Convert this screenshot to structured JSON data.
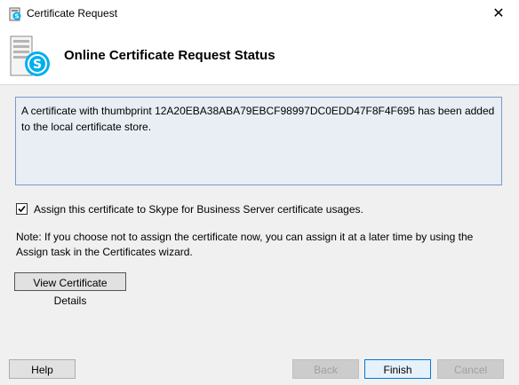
{
  "window": {
    "title": "Certificate Request",
    "close_glyph": "✕",
    "icon": "skype-certificate-icon"
  },
  "header": {
    "title": "Online Certificate Request Status",
    "icon": "server-skype-icon"
  },
  "status": {
    "message": "A certificate with thumbprint 12A20EBA38ABA79EBCF98997DC0EDD47F8F4F695 has been added to the local certificate store."
  },
  "assign": {
    "checked": true,
    "label": "Assign this certificate to Skype for Business Server certificate usages."
  },
  "note": "Note: If you choose not to assign the certificate now, you can assign it at a later time by using the Assign task in the Certificates wizard.",
  "buttons": {
    "view_details": "View Certificate Details",
    "help": "Help",
    "back": "Back",
    "finish": "Finish",
    "cancel": "Cancel"
  },
  "colors": {
    "skype_blue": "#00aff0",
    "focus_border": "#0078d7",
    "status_box_bg": "#e8eef4"
  }
}
